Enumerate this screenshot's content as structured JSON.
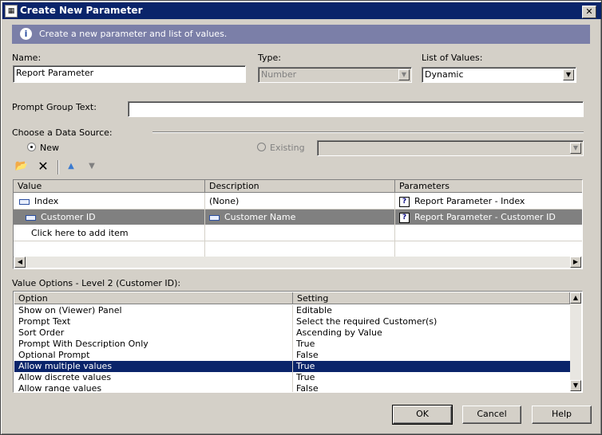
{
  "window": {
    "title": "Create New Parameter",
    "close_glyph": "✕"
  },
  "info": {
    "text": "Create a new parameter and list of values."
  },
  "name": {
    "label": "Name:",
    "value": "Report Parameter"
  },
  "type": {
    "label": "Type:",
    "value": "Number"
  },
  "list_of_values": {
    "label": "List of Values:",
    "value": "Dynamic"
  },
  "prompt_group": {
    "label": "Prompt Group Text:",
    "value": ""
  },
  "data_source": {
    "label": "Choose a Data Source:",
    "new_label": "New",
    "existing_label": "Existing",
    "existing_value": ""
  },
  "toolbar": {
    "icons": [
      "open-folder-icon",
      "delete-icon",
      "move-up-icon",
      "move-down-icon"
    ]
  },
  "value_grid": {
    "columns": [
      "Value",
      "Description",
      "Parameters"
    ],
    "rows": [
      {
        "value": "Index",
        "description": "(None)",
        "parameters": "Report Parameter - Index"
      },
      {
        "value": "Customer ID",
        "description": "Customer Name",
        "parameters": "Report Parameter - Customer ID"
      }
    ],
    "add_item": "Click here to add item"
  },
  "value_options": {
    "label": "Value Options - Level 2 (Customer ID):",
    "columns": [
      "Option",
      "Setting"
    ],
    "rows": [
      {
        "option": "Show on (Viewer) Panel",
        "setting": "Editable"
      },
      {
        "option": "Prompt Text",
        "setting": "Select the required Customer(s)"
      },
      {
        "option": "Sort Order",
        "setting": "Ascending by Value"
      },
      {
        "option": "Prompt With Description Only",
        "setting": "True"
      },
      {
        "option": "Optional Prompt",
        "setting": "False"
      },
      {
        "option": "Allow multiple values",
        "setting": "True"
      },
      {
        "option": "Allow discrete values",
        "setting": "True"
      },
      {
        "option": "Allow range values",
        "setting": "False"
      }
    ]
  },
  "buttons": {
    "ok": "OK",
    "cancel": "Cancel",
    "help": "Help"
  },
  "colors": {
    "title_bar": "#0a246a",
    "info_bar": "#7b7fa8",
    "selection": "#0a246a",
    "row_highlight": "#808080"
  }
}
